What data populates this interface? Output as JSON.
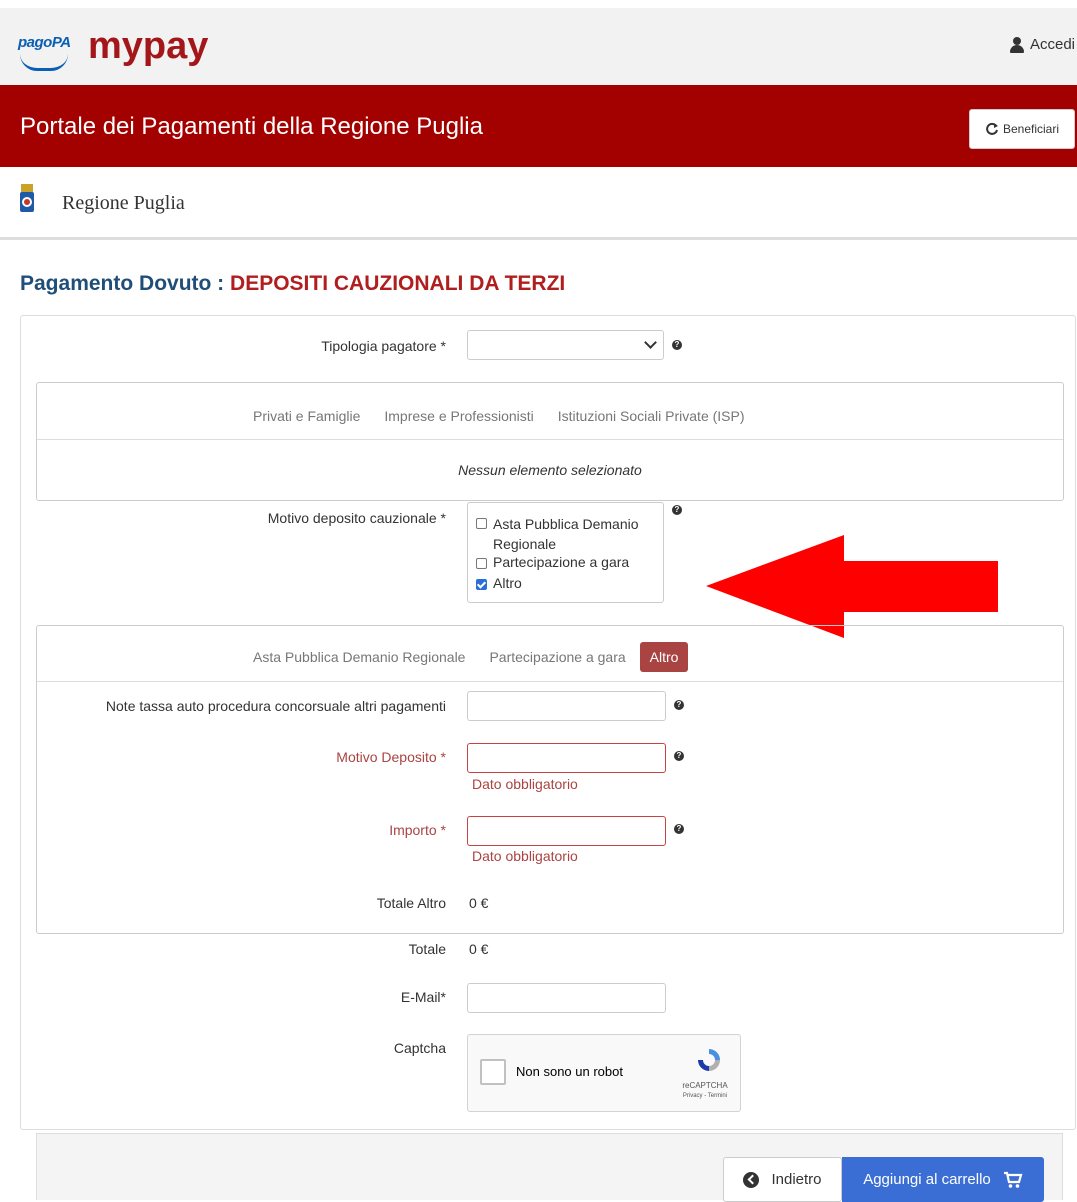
{
  "header": {
    "logo_pagopa": "pagoPA",
    "logo_mypay": "mypay",
    "login_label": "Accedi",
    "portal_title": "Portale dei Pagamenti della Regione Puglia",
    "beneficiari_label": "Beneficiari",
    "region_name": "Regione Puglia"
  },
  "colors": {
    "brand_red": "#a30000",
    "title_blue": "#1f4e79",
    "error_red": "#a94442",
    "primary_blue": "#3a6ed4",
    "arrow_red": "#ff0000"
  },
  "page": {
    "title_prefix": "Pagamento Dovuto :",
    "title_highlight": "DEPOSITI CAUZIONALI DA TERZI"
  },
  "form": {
    "tipologia_label": "Tipologia pagatore *",
    "tipologia_value": "",
    "payer_tabs": [
      "Privati e Famiglie",
      "Imprese e Professionisti",
      "Istituzioni Sociali Private (ISP)"
    ],
    "no_selection": "Nessun elemento selezionato",
    "motivo_cauzionale_label": "Motivo deposito cauzionale *",
    "motivo_options": [
      {
        "label": "Asta Pubblica Demanio Regionale",
        "checked": false
      },
      {
        "label": "Partecipazione a gara",
        "checked": false
      },
      {
        "label": "Altro",
        "checked": true
      }
    ],
    "section_tabs": [
      "Asta Pubblica Demanio Regionale",
      "Partecipazione a gara"
    ],
    "section_tab_active": "Altro",
    "note_label": "Note tassa auto procedura concorsuale altri pagamenti",
    "note_value": "",
    "motivo_deposito_label": "Motivo Deposito *",
    "motivo_deposito_value": "",
    "importo_label": "Importo *",
    "importo_value": "",
    "error_required": "Dato obbligatorio",
    "totale_altro_label": "Totale Altro",
    "totale_altro_value": "0 €",
    "totale_label": "Totale",
    "totale_value": "0 €",
    "email_label": "E-Mail*",
    "email_value": "",
    "captcha_label": "Captcha",
    "captcha_text": "Non sono un robot",
    "captcha_brand": "reCAPTCHA",
    "captcha_links": "Privacy - Termini"
  },
  "footer": {
    "back_label": "Indietro",
    "cart_label": "Aggiungi al carrello"
  },
  "icons": {
    "user": "user-icon",
    "refresh": "refresh-icon",
    "help": "help-icon",
    "chevron": "chevron-down-icon",
    "back": "chevron-circle-left-icon",
    "cart": "shopping-cart-icon",
    "annotation": "red-arrow-left"
  }
}
